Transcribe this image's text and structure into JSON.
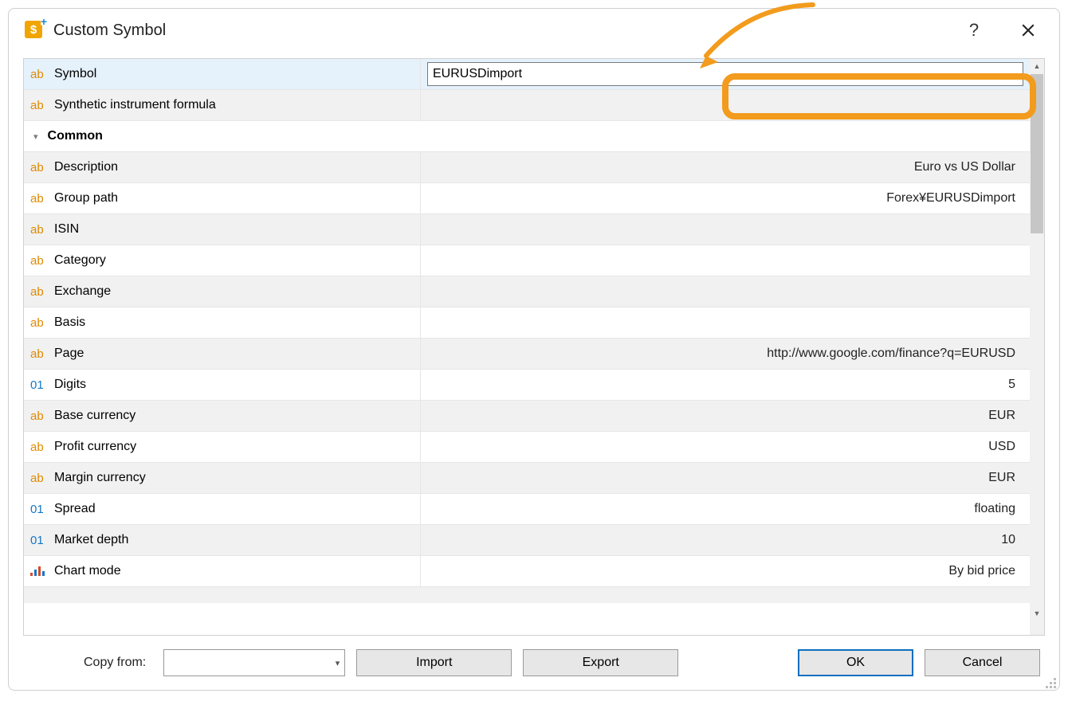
{
  "window": {
    "title": "Custom Symbol"
  },
  "rows": {
    "symbol": {
      "label": "Symbol",
      "value": "EURUSDimport"
    },
    "formula": {
      "label": "Synthetic instrument formula",
      "value": ""
    },
    "section_common": {
      "label": "Common"
    },
    "description": {
      "label": "Description",
      "value": "Euro vs US Dollar"
    },
    "group_path": {
      "label": "Group path",
      "value": "Forex¥EURUSDimport"
    },
    "isin": {
      "label": "ISIN",
      "value": ""
    },
    "category": {
      "label": "Category",
      "value": ""
    },
    "exchange": {
      "label": "Exchange",
      "value": ""
    },
    "basis": {
      "label": "Basis",
      "value": ""
    },
    "page": {
      "label": "Page",
      "value": "http://www.google.com/finance?q=EURUSD"
    },
    "digits": {
      "label": "Digits",
      "value": "5"
    },
    "base_ccy": {
      "label": "Base currency",
      "value": "EUR"
    },
    "profit_ccy": {
      "label": "Profit currency",
      "value": "USD"
    },
    "margin_ccy": {
      "label": "Margin currency",
      "value": "EUR"
    },
    "spread": {
      "label": "Spread",
      "value": "floating"
    },
    "market_depth": {
      "label": "Market depth",
      "value": "10"
    },
    "chart_mode": {
      "label": "Chart mode",
      "value": "By bid price"
    }
  },
  "footer": {
    "copy_from": "Copy from:",
    "import": "Import",
    "export": "Export",
    "ok": "OK",
    "cancel": "Cancel"
  }
}
